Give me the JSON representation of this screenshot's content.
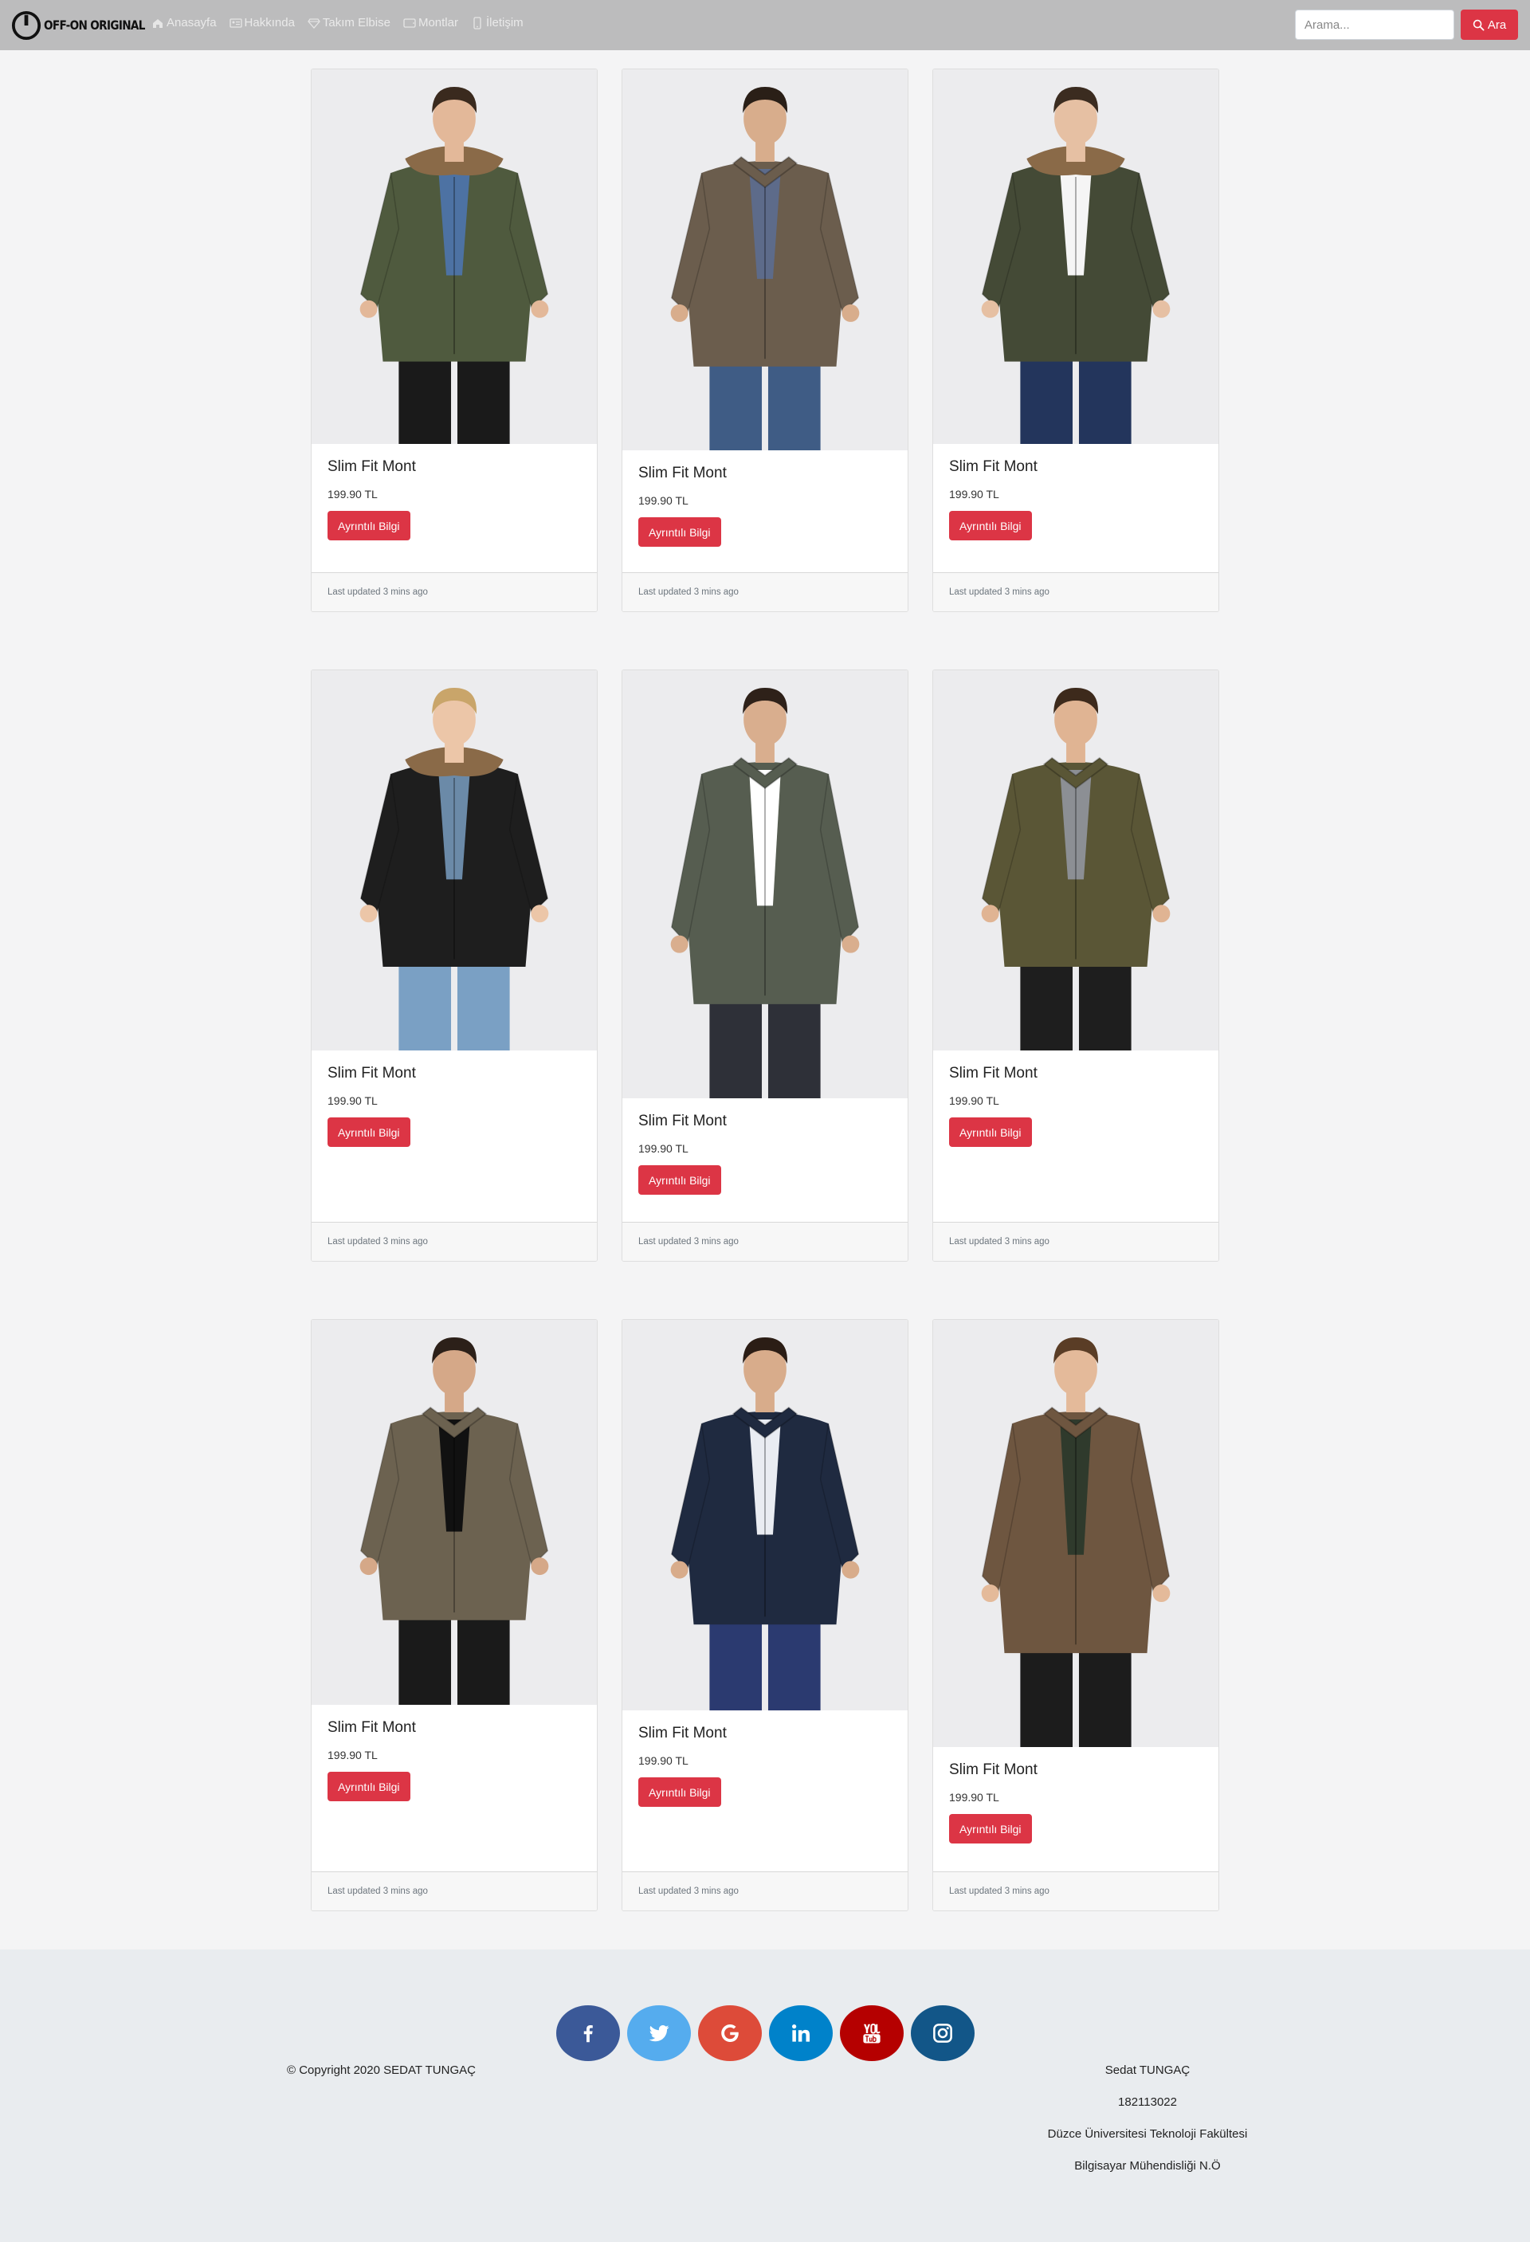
{
  "navbar": {
    "brand": "OFF-ON ORIGINAL",
    "links": [
      {
        "label": "Anasayfa",
        "icon": "home-icon"
      },
      {
        "label": "Hakkında",
        "icon": "id-card-icon"
      },
      {
        "label": "Takım Elbise",
        "icon": "diamond-icon"
      },
      {
        "label": "Montlar",
        "icon": "tablet-icon"
      },
      {
        "label": "İletişim",
        "icon": "phone-icon"
      }
    ],
    "search_placeholder": "Arama...",
    "search_button": "Ara"
  },
  "colors": {
    "navbar_bg": "#bcbcbd",
    "accent": "#dc3545",
    "page_bg": "#f4f4f5",
    "footer_bg": "#e9ecef"
  },
  "products": [
    {
      "title": "Slim Fit Mont",
      "price": "199.90 TL",
      "button": "Ayrıntılı Bilgi",
      "updated": "Last updated 3 mins ago",
      "image": "man in olive parka with fur hood",
      "coat_color": "#4f5a3e",
      "fur": true
    },
    {
      "title": "Slim Fit Mont",
      "price": "199.90 TL",
      "button": "Ayrıntılı Bilgi",
      "updated": "Last updated 3 mins ago",
      "image": "man in brown belted field jacket",
      "coat_color": "#6b5d4d",
      "fur": false
    },
    {
      "title": "Slim Fit Mont",
      "price": "199.90 TL",
      "button": "Ayrıntılı Bilgi",
      "updated": "Last updated 3 mins ago",
      "image": "man in khaki parka with fur hood",
      "coat_color": "#444a36",
      "fur": true
    },
    {
      "title": "Slim Fit Mont",
      "price": "199.90 TL",
      "button": "Ayrıntılı Bilgi",
      "updated": "Last updated 3 mins ago",
      "image": "man in black parka with fleece lining",
      "coat_color": "#1e1e1e",
      "fur": true
    },
    {
      "title": "Slim Fit Mont",
      "price": "199.90 TL",
      "button": "Ayrıntılı Bilgi",
      "updated": "Last updated 3 mins ago",
      "image": "man in grey green jacket with checked shirt",
      "coat_color": "#565d50",
      "fur": false
    },
    {
      "title": "Slim Fit Mont",
      "price": "199.90 TL",
      "button": "Ayrıntılı Bilgi",
      "updated": "Last updated 3 mins ago",
      "image": "man in olive short jacket",
      "coat_color": "#5a5636",
      "fur": false
    },
    {
      "title": "Slim Fit Mont",
      "price": "199.90 TL",
      "button": "Ayrıntılı Bilgi",
      "updated": "Last updated 3 mins ago",
      "image": "man in brown trench coat",
      "coat_color": "#6c6250",
      "fur": false
    },
    {
      "title": "Slim Fit Mont",
      "price": "199.90 TL",
      "button": "Ayrıntılı Bilgi",
      "updated": "Last updated 3 mins ago",
      "image": "man in navy trench coat",
      "coat_color": "#1f2a40",
      "fur": false
    },
    {
      "title": "Slim Fit Mont",
      "price": "199.90 TL",
      "button": "Ayrıntılı Bilgi",
      "updated": "Last updated 3 mins ago",
      "image": "man in brown hooded parka",
      "coat_color": "#6e5640",
      "fur": false
    }
  ],
  "footer": {
    "social": [
      {
        "name": "facebook",
        "icon": "facebook-icon",
        "color": "#3b5998"
      },
      {
        "name": "twitter",
        "icon": "twitter-icon",
        "color": "#55acee"
      },
      {
        "name": "google",
        "icon": "google-icon",
        "color": "#dd4b39"
      },
      {
        "name": "linkedin",
        "icon": "linkedin-icon",
        "color": "#0082ca"
      },
      {
        "name": "youtube",
        "icon": "youtube-icon",
        "color": "#b50000"
      },
      {
        "name": "instagram",
        "icon": "instagram-icon",
        "color": "#125688"
      }
    ],
    "copyright": "© Copyright 2020 SEDAT TUNGAÇ",
    "info": [
      "Sedat TUNGAÇ",
      "182113022",
      "Düzce Üniversitesi Teknoloji Fakültesi",
      "Bilgisayar Mühendisliği N.Ö"
    ]
  }
}
